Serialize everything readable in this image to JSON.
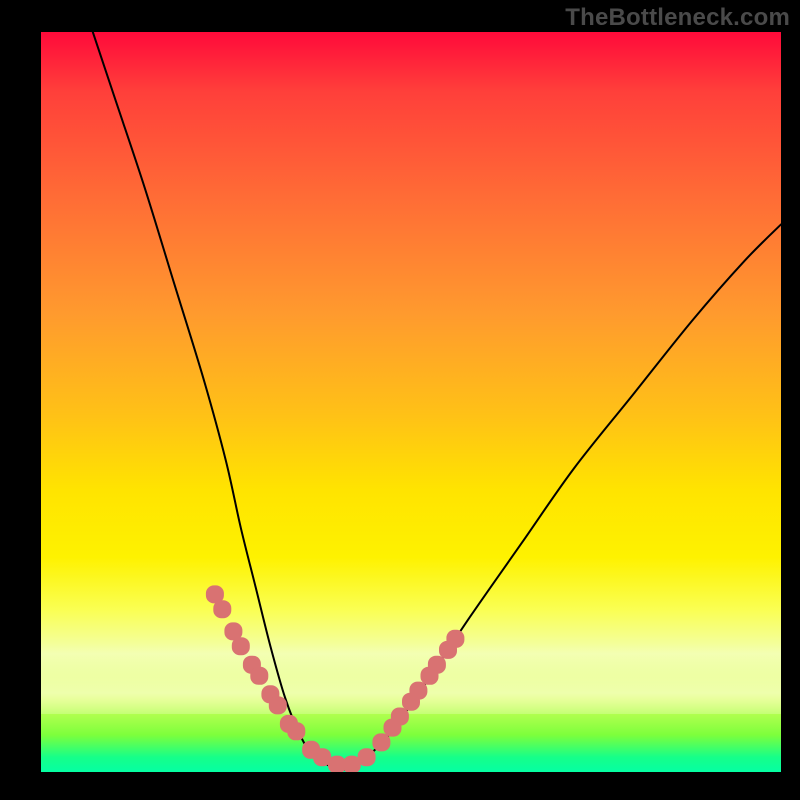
{
  "watermark": "TheBottleneck.com",
  "chart_data": {
    "type": "line",
    "title": "",
    "xlabel": "",
    "ylabel": "",
    "xlim": [
      0,
      100
    ],
    "ylim": [
      0,
      100
    ],
    "background_gradient": {
      "top_color": "#ff0a3a",
      "mid_color": "#ffe400",
      "bottom_color": "#05ffa3"
    },
    "series": [
      {
        "name": "bottleneck-curve",
        "color": "#000000",
        "x": [
          7,
          10,
          14,
          18,
          22,
          25,
          27,
          29,
          31,
          33,
          35,
          37,
          40,
          42,
          44,
          47,
          52,
          58,
          65,
          72,
          80,
          88,
          95,
          100
        ],
        "y": [
          100,
          91,
          79,
          66,
          53,
          42,
          33,
          25,
          17,
          10,
          5,
          2,
          0.5,
          0.5,
          2,
          5,
          12,
          21,
          31,
          41,
          51,
          61,
          69,
          74
        ]
      },
      {
        "name": "marker-dots",
        "color": "#d97272",
        "type": "scatter",
        "x": [
          23.5,
          24.5,
          26,
          27,
          28.5,
          29.5,
          31,
          32,
          33.5,
          34.5,
          36.5,
          38,
          40,
          42,
          44,
          46,
          47.5,
          48.5,
          50,
          51,
          52.5,
          53.5,
          55,
          56
        ],
        "y": [
          24,
          22,
          19,
          17,
          14.5,
          13,
          10.5,
          9,
          6.5,
          5.5,
          3,
          2,
          1,
          1,
          2,
          4,
          6,
          7.5,
          9.5,
          11,
          13,
          14.5,
          16.5,
          18
        ]
      }
    ]
  }
}
